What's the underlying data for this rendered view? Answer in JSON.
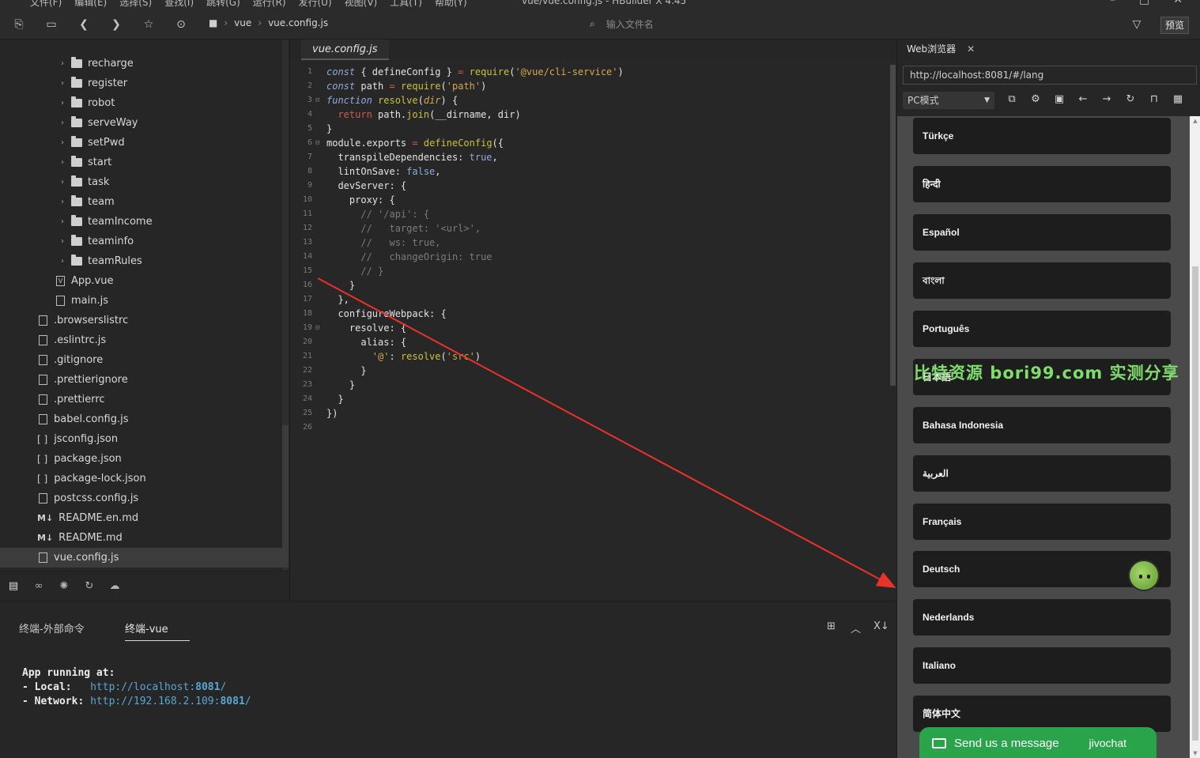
{
  "menubar": {
    "items": [
      "文件(F)",
      "编辑(E)",
      "选择(S)",
      "查找(I)",
      "跳转(G)",
      "运行(R)",
      "发行(U)",
      "视图(V)",
      "工具(T)",
      "帮助(Y)"
    ],
    "window_title": "vue/vue.config.js - HBuilder X 4.45"
  },
  "toolbar": {
    "breadcrumb": [
      "vue",
      "vue.config.js"
    ],
    "search_placeholder": "输入文件名",
    "preview_label": "预览"
  },
  "tree": {
    "folders": [
      "recharge",
      "register",
      "robot",
      "serveWay",
      "setPwd",
      "start",
      "task",
      "team",
      "teamIncome",
      "teaminfo",
      "teamRules"
    ],
    "src_files": [
      "App.vue",
      "main.js"
    ],
    "root_files": [
      ".browserslistrc",
      ".eslintrc.js",
      ".gitignore",
      ".prettierignore",
      ".prettierrc",
      "babel.config.js",
      "jsconfig.json",
      "package.json",
      "package-lock.json",
      "postcss.config.js",
      "README.en.md",
      "README.md",
      "vue.config.js"
    ]
  },
  "editor": {
    "tab": "vue.config.js"
  },
  "terminal": {
    "tabs": [
      "终端-外部命令",
      "终端-vue"
    ],
    "line1": "App running at:",
    "line2_label": "- Local:   ",
    "line2_url": "http://localhost:",
    "line2_port": "8081",
    "line3_label": "- Network: ",
    "line3_url": "http://192.168.2.109:",
    "line3_port": "8081",
    "slash": "/"
  },
  "browser": {
    "tab": "Web浏览器",
    "address": "http://localhost:8081/#/lang",
    "mode": "PC模式",
    "languages": [
      "Türkçe",
      "हिन्दी",
      "Español",
      "বাংলা",
      "Português",
      "日本語",
      "Bahasa Indonesia",
      "العربية",
      "Français",
      "Deutsch",
      "Nederlands",
      "Italiano",
      "简体中文"
    ],
    "chat_label": "Send us a message",
    "chat_brand": "jivochat"
  },
  "watermark": "比特资源 bori99.com 实测分享",
  "colors": {
    "accent_arrow": "#e8322a",
    "chat_green": "#2aa44a"
  }
}
